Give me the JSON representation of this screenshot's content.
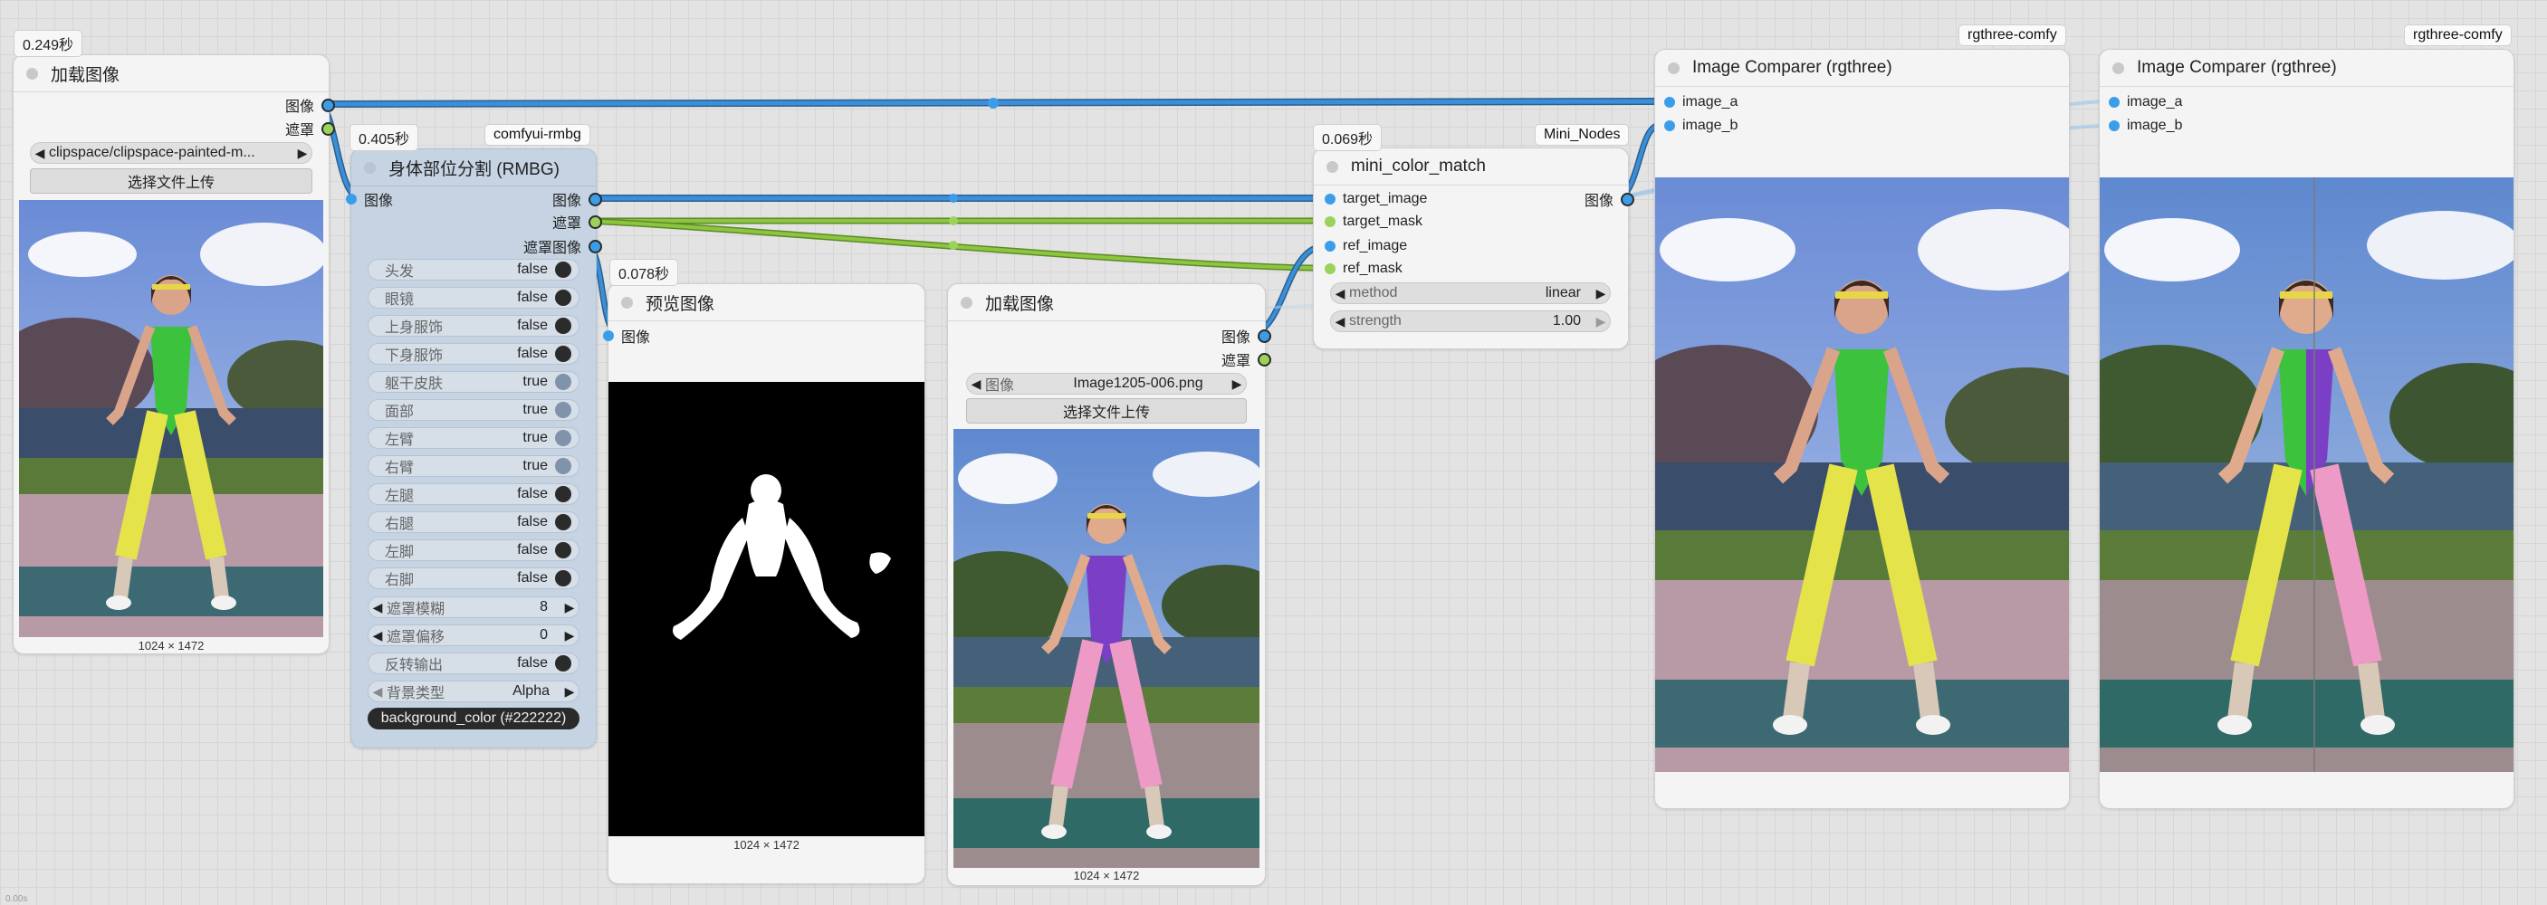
{
  "colors": {
    "image_wire": "#3a8fd9",
    "mask_wire": "#8cc63f",
    "image_port": "#3b9de8",
    "mask_port": "#9bd35a"
  },
  "loadImage1": {
    "time": "0.249秒",
    "title": "加载图像",
    "out_image": "图像",
    "out_mask": "遮罩",
    "file": "clipspace/clipspace-painted-m...",
    "upload": "选择文件上传",
    "size": "1024 × 1472"
  },
  "rmbg": {
    "time": "0.405秒",
    "tag": "comfyui-rmbg",
    "title": "身体部位分割 (RMBG)",
    "in_image": "图像",
    "out_image": "图像",
    "out_mask": "遮罩",
    "out_mask_image": "遮罩图像",
    "toggles": [
      {
        "label": "头发",
        "value": "false"
      },
      {
        "label": "眼镜",
        "value": "false"
      },
      {
        "label": "上身服饰",
        "value": "false"
      },
      {
        "label": "下身服饰",
        "value": "false"
      },
      {
        "label": "躯干皮肤",
        "value": "true"
      },
      {
        "label": "面部",
        "value": "true"
      },
      {
        "label": "左臂",
        "value": "true"
      },
      {
        "label": "右臂",
        "value": "true"
      },
      {
        "label": "左腿",
        "value": "false"
      },
      {
        "label": "右腿",
        "value": "false"
      },
      {
        "label": "左脚",
        "value": "false"
      },
      {
        "label": "右脚",
        "value": "false"
      }
    ],
    "mask_blur_label": "遮罩模糊",
    "mask_blur": "8",
    "mask_offset_label": "遮罩偏移",
    "mask_offset": "0",
    "invert_label": "反转输出",
    "invert": "false",
    "bg_type_label": "背景类型",
    "bg_type": "Alpha",
    "bg_color": "background_color (#222222)"
  },
  "preview": {
    "time": "0.078秒",
    "title": "预览图像",
    "in_image": "图像",
    "size": "1024 × 1472"
  },
  "loadImage2": {
    "title": "加载图像",
    "out_image": "图像",
    "out_mask": "遮罩",
    "file_label": "图像",
    "file": "Image1205-006.png",
    "upload": "选择文件上传",
    "size": "1024 × 1472"
  },
  "colorMatch": {
    "time": "0.069秒",
    "tag": "Mini_Nodes",
    "title": "mini_color_match",
    "in_target_image": "target_image",
    "in_target_mask": "target_mask",
    "in_ref_image": "ref_image",
    "in_ref_mask": "ref_mask",
    "out_image": "图像",
    "method_label": "method",
    "method": "linear",
    "strength_label": "strength",
    "strength": "1.00"
  },
  "comparer1": {
    "tag": "rgthree-comfy",
    "title": "Image Comparer (rgthree)",
    "in_a": "image_a",
    "in_b": "image_b"
  },
  "comparer2": {
    "tag": "rgthree-comfy",
    "title": "Image Comparer (rgthree)",
    "in_a": "image_a",
    "in_b": "image_b"
  },
  "footer": {
    "fps": "0.00s"
  }
}
